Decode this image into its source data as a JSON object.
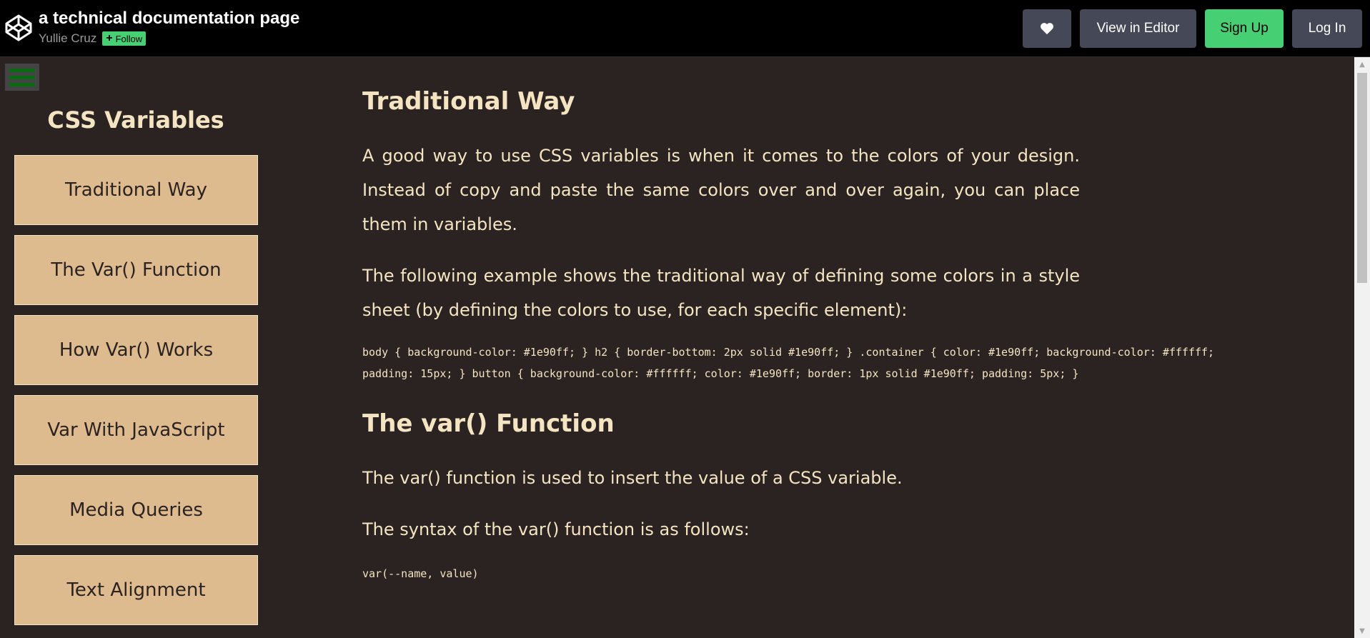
{
  "header": {
    "title": "a technical documentation page",
    "author": "Yullie Cruz",
    "follow_label": "Follow",
    "heart_icon": "heart-icon",
    "view_in_editor_label": "View in Editor",
    "sign_up_label": "Sign Up",
    "log_in_label": "Log In"
  },
  "sidebar": {
    "menu_icon": "hamburger-menu-icon",
    "title": "CSS Variables",
    "items": [
      {
        "label": "Traditional Way"
      },
      {
        "label": "The Var() Function"
      },
      {
        "label": "How Var() Works"
      },
      {
        "label": "Var With JavaScript"
      },
      {
        "label": "Media Queries"
      },
      {
        "label": "Text Alignment"
      }
    ]
  },
  "main": {
    "sections": [
      {
        "heading": "Traditional Way",
        "paragraphs": [
          "A good way to use CSS variables is when it comes to the colors of your design. Instead of copy and paste the same colors over and over again, you can place them in variables.",
          "The following example shows the traditional way of defining some colors in a style sheet (by defining the colors to use, for each specific element):"
        ],
        "code": "body { background-color: #1e90ff; } h2 { border-bottom: 2px solid #1e90ff; } .container { color: #1e90ff; background-color: #ffffff; padding: 15px; } button { background-color: #ffffff; color: #1e90ff; border: 1px solid #1e90ff; padding: 5px; }"
      },
      {
        "heading": "The var() Function",
        "paragraphs": [
          "The var() function is used to insert the value of a CSS variable.",
          "The syntax of the var() function is as follows:"
        ],
        "code": "var(--name, value)"
      }
    ]
  },
  "colors": {
    "background": "#2b2321",
    "text": "#f4e4c2",
    "nav_button": "#deba8f",
    "topbar": "#000000",
    "topbar_button": "#444857",
    "accent_green": "#47cf73",
    "hamburger_bars": "#0a6a12"
  }
}
